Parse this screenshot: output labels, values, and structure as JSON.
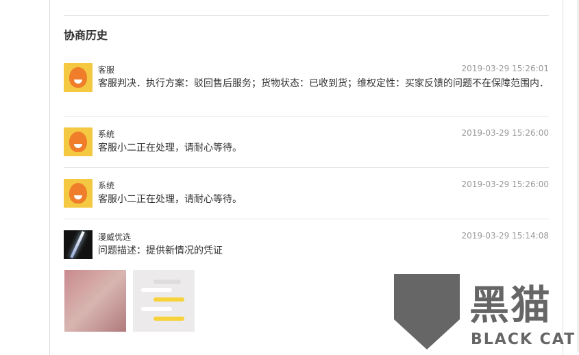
{
  "section_title": "协商历史",
  "history": [
    {
      "name": "客服",
      "time": "2019-03-29 15:26:01",
      "text": "客服判决．执行方案：驳回售后服务；货物状态：已收到货；维权定性：买家反馈的问题不在保障范围内．",
      "avatar": "mascot"
    },
    {
      "name": "系统",
      "time": "2019-03-29 15:26:00",
      "text": "客服小二正在处理，请耐心等待。",
      "avatar": "mascot"
    },
    {
      "name": "系统",
      "time": "2019-03-29 15:26:00",
      "text": "客服小二正在处理，请耐心等待。",
      "avatar": "mascot"
    },
    {
      "name": "漫威优选",
      "time": "2019-03-29 15:14:08",
      "text": "问题描述：提供新情况的凭证",
      "avatar": "space"
    }
  ],
  "watermark": {
    "cn": "黑猫",
    "en": "BLACK CAT"
  }
}
